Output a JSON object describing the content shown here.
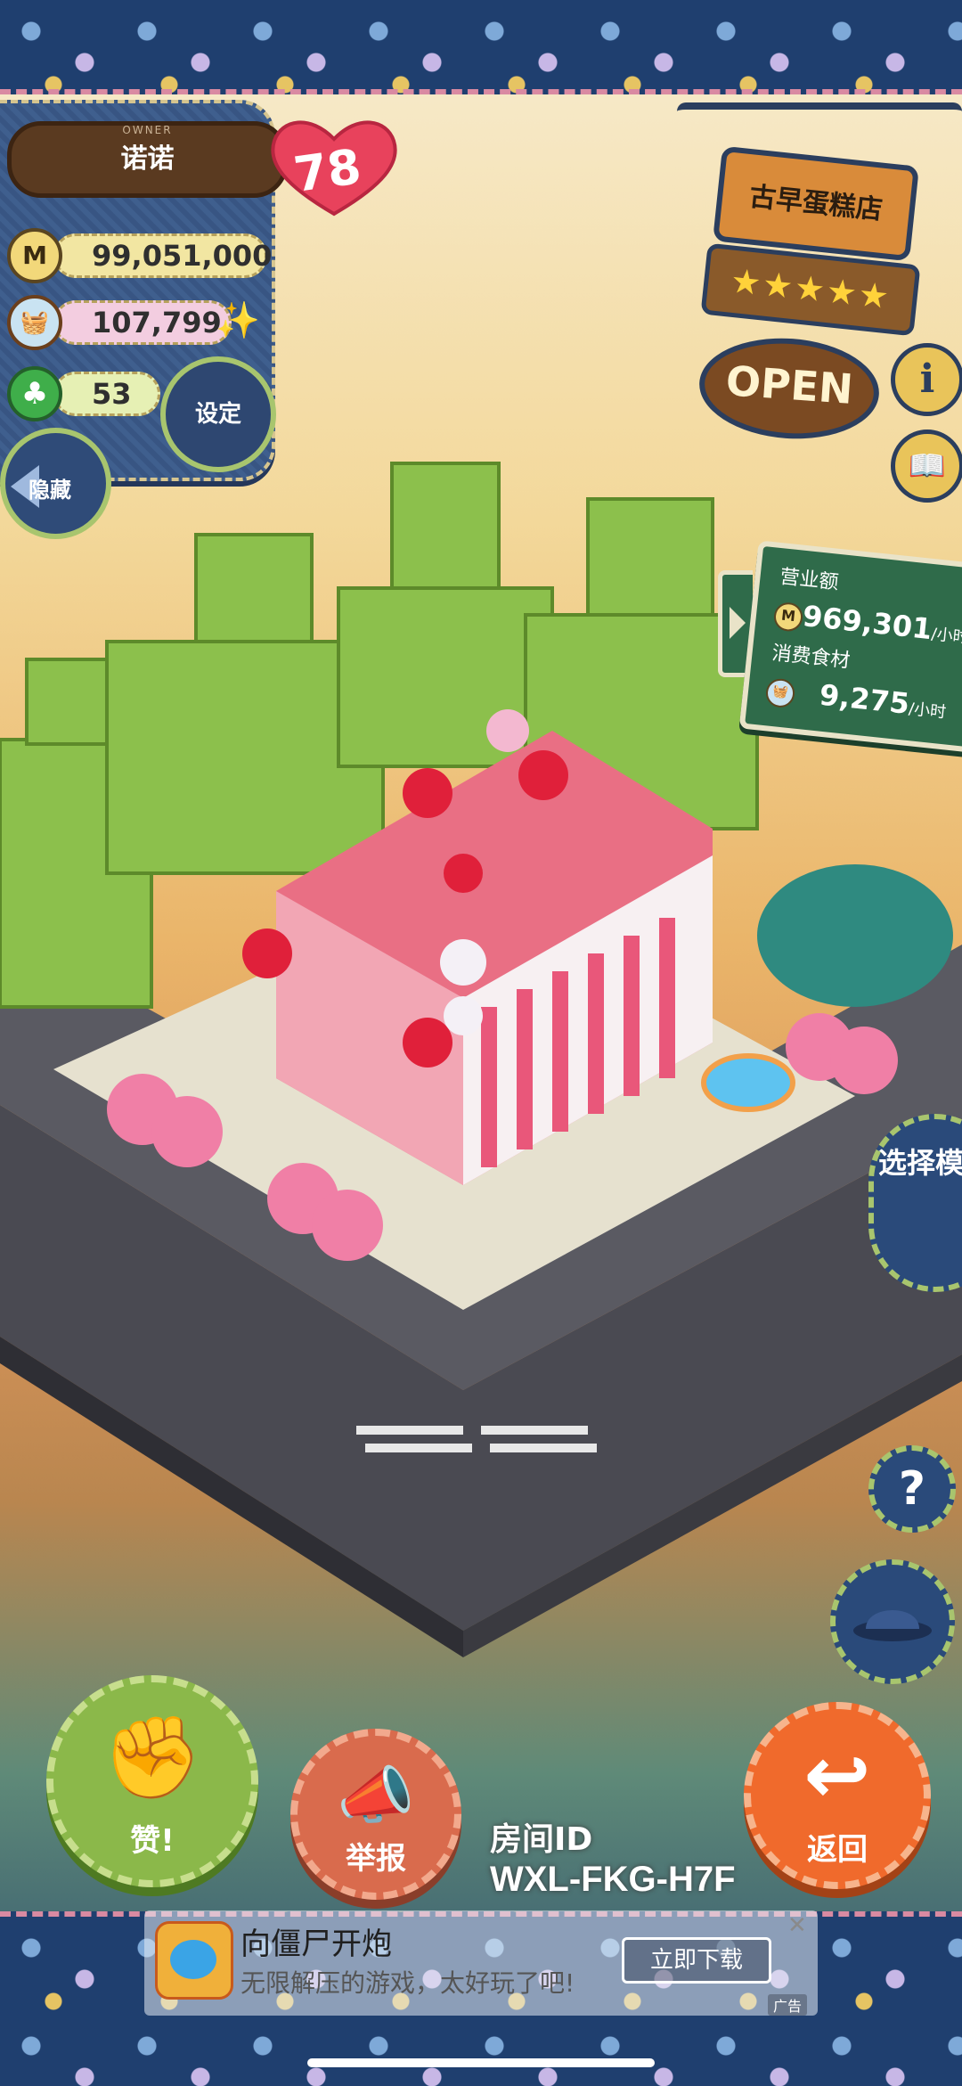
{
  "owner": {
    "tag": "OWNER",
    "name": "诺诺",
    "hearts": "78",
    "coin_symbol": "M",
    "coins": "99,051,000",
    "food": "107,799",
    "clovers": "53",
    "settings_label": "设定",
    "hide_label": "隐藏"
  },
  "shop": {
    "name": "古早蛋糕店",
    "rating_stars": "★★★★★",
    "status": "OPEN",
    "info_glyph": "i",
    "book_glyph": "📖"
  },
  "revenue": {
    "revenue_label": "营业额",
    "revenue_value": "969,301",
    "revenue_unit": "/小时",
    "food_label": "消费食材",
    "food_value": "9,275",
    "food_unit": "/小时"
  },
  "side": {
    "mode_label": "选择模式",
    "help_glyph": "?"
  },
  "actions": {
    "like_label": "赞!",
    "report_label": "举报",
    "back_label": "返回"
  },
  "room": {
    "id_label": "房间ID",
    "id_value": "WXL-FKG-H7F"
  },
  "ad": {
    "title": "向僵尸开炮",
    "subtitle": "无限解压的游戏，太好玩了吧!",
    "cta": "立即下载",
    "close": "✕",
    "tag": "广告"
  },
  "colors": {
    "denim": "#3f5f8e",
    "heart": "#e8425c",
    "like": "#8bb84a",
    "report": "#d96b4d",
    "back": "#f06a2c",
    "board": "#2f6b4a"
  }
}
